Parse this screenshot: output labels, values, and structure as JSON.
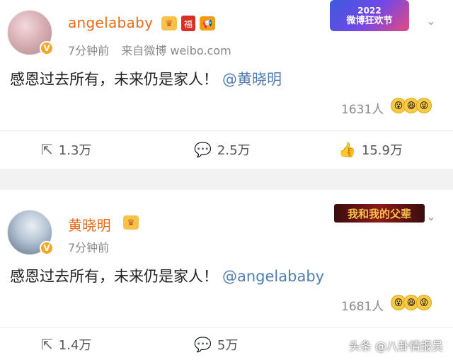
{
  "posts": [
    {
      "username": "angelababy",
      "time": "7分钟前",
      "source": "来自微博 weibo.com",
      "content": "感恩过去所有，未来仍是家人！",
      "mention": "@黄晓明",
      "like_people": "1631人",
      "repost_count": "1.3万",
      "comment_count": "2.5万",
      "like_count": "15.9万",
      "banner_year": "2022",
      "banner_title": "微博狂欢节"
    },
    {
      "username": "黄晓明",
      "time": "7分钟前",
      "content": "感恩过去所有，未来仍是家人！",
      "mention": "@angelababy",
      "like_people": "1681人",
      "repost_count": "1.4万",
      "comment_count": "5万",
      "banner_title": "我和我的父辈",
      "title_art": "我和我的父辈"
    }
  ],
  "badges": {
    "fu": "福"
  },
  "watermark": "头条 @八卦情报员",
  "colors": {
    "username": "#e86a19",
    "mention": "#507daf",
    "meta": "#888888",
    "gap": "#f2f2f2"
  }
}
